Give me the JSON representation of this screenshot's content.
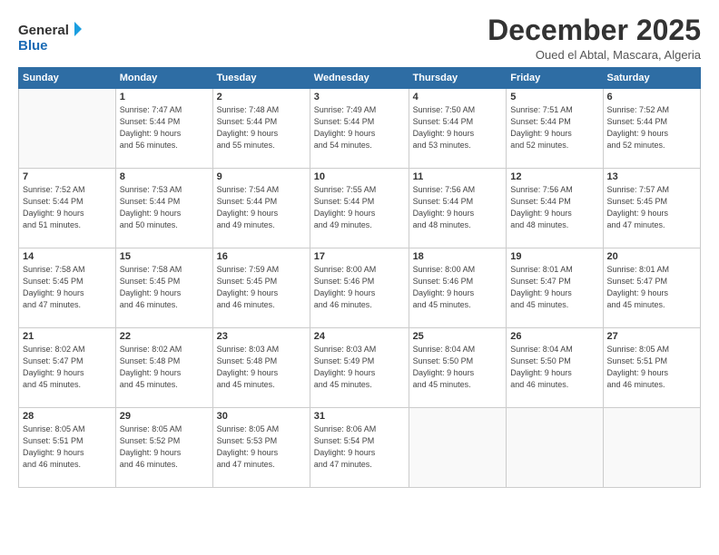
{
  "logo": {
    "line1": "General",
    "line2": "Blue"
  },
  "title": "December 2025",
  "subtitle": "Oued el Abtal, Mascara, Algeria",
  "days_of_week": [
    "Sunday",
    "Monday",
    "Tuesday",
    "Wednesday",
    "Thursday",
    "Friday",
    "Saturday"
  ],
  "weeks": [
    [
      {
        "day": "",
        "info": ""
      },
      {
        "day": "1",
        "info": "Sunrise: 7:47 AM\nSunset: 5:44 PM\nDaylight: 9 hours\nand 56 minutes."
      },
      {
        "day": "2",
        "info": "Sunrise: 7:48 AM\nSunset: 5:44 PM\nDaylight: 9 hours\nand 55 minutes."
      },
      {
        "day": "3",
        "info": "Sunrise: 7:49 AM\nSunset: 5:44 PM\nDaylight: 9 hours\nand 54 minutes."
      },
      {
        "day": "4",
        "info": "Sunrise: 7:50 AM\nSunset: 5:44 PM\nDaylight: 9 hours\nand 53 minutes."
      },
      {
        "day": "5",
        "info": "Sunrise: 7:51 AM\nSunset: 5:44 PM\nDaylight: 9 hours\nand 52 minutes."
      },
      {
        "day": "6",
        "info": "Sunrise: 7:52 AM\nSunset: 5:44 PM\nDaylight: 9 hours\nand 52 minutes."
      }
    ],
    [
      {
        "day": "7",
        "info": "Sunrise: 7:52 AM\nSunset: 5:44 PM\nDaylight: 9 hours\nand 51 minutes."
      },
      {
        "day": "8",
        "info": "Sunrise: 7:53 AM\nSunset: 5:44 PM\nDaylight: 9 hours\nand 50 minutes."
      },
      {
        "day": "9",
        "info": "Sunrise: 7:54 AM\nSunset: 5:44 PM\nDaylight: 9 hours\nand 49 minutes."
      },
      {
        "day": "10",
        "info": "Sunrise: 7:55 AM\nSunset: 5:44 PM\nDaylight: 9 hours\nand 49 minutes."
      },
      {
        "day": "11",
        "info": "Sunrise: 7:56 AM\nSunset: 5:44 PM\nDaylight: 9 hours\nand 48 minutes."
      },
      {
        "day": "12",
        "info": "Sunrise: 7:56 AM\nSunset: 5:44 PM\nDaylight: 9 hours\nand 48 minutes."
      },
      {
        "day": "13",
        "info": "Sunrise: 7:57 AM\nSunset: 5:45 PM\nDaylight: 9 hours\nand 47 minutes."
      }
    ],
    [
      {
        "day": "14",
        "info": "Sunrise: 7:58 AM\nSunset: 5:45 PM\nDaylight: 9 hours\nand 47 minutes."
      },
      {
        "day": "15",
        "info": "Sunrise: 7:58 AM\nSunset: 5:45 PM\nDaylight: 9 hours\nand 46 minutes."
      },
      {
        "day": "16",
        "info": "Sunrise: 7:59 AM\nSunset: 5:45 PM\nDaylight: 9 hours\nand 46 minutes."
      },
      {
        "day": "17",
        "info": "Sunrise: 8:00 AM\nSunset: 5:46 PM\nDaylight: 9 hours\nand 46 minutes."
      },
      {
        "day": "18",
        "info": "Sunrise: 8:00 AM\nSunset: 5:46 PM\nDaylight: 9 hours\nand 45 minutes."
      },
      {
        "day": "19",
        "info": "Sunrise: 8:01 AM\nSunset: 5:47 PM\nDaylight: 9 hours\nand 45 minutes."
      },
      {
        "day": "20",
        "info": "Sunrise: 8:01 AM\nSunset: 5:47 PM\nDaylight: 9 hours\nand 45 minutes."
      }
    ],
    [
      {
        "day": "21",
        "info": "Sunrise: 8:02 AM\nSunset: 5:47 PM\nDaylight: 9 hours\nand 45 minutes."
      },
      {
        "day": "22",
        "info": "Sunrise: 8:02 AM\nSunset: 5:48 PM\nDaylight: 9 hours\nand 45 minutes."
      },
      {
        "day": "23",
        "info": "Sunrise: 8:03 AM\nSunset: 5:48 PM\nDaylight: 9 hours\nand 45 minutes."
      },
      {
        "day": "24",
        "info": "Sunrise: 8:03 AM\nSunset: 5:49 PM\nDaylight: 9 hours\nand 45 minutes."
      },
      {
        "day": "25",
        "info": "Sunrise: 8:04 AM\nSunset: 5:50 PM\nDaylight: 9 hours\nand 45 minutes."
      },
      {
        "day": "26",
        "info": "Sunrise: 8:04 AM\nSunset: 5:50 PM\nDaylight: 9 hours\nand 46 minutes."
      },
      {
        "day": "27",
        "info": "Sunrise: 8:05 AM\nSunset: 5:51 PM\nDaylight: 9 hours\nand 46 minutes."
      }
    ],
    [
      {
        "day": "28",
        "info": "Sunrise: 8:05 AM\nSunset: 5:51 PM\nDaylight: 9 hours\nand 46 minutes."
      },
      {
        "day": "29",
        "info": "Sunrise: 8:05 AM\nSunset: 5:52 PM\nDaylight: 9 hours\nand 46 minutes."
      },
      {
        "day": "30",
        "info": "Sunrise: 8:05 AM\nSunset: 5:53 PM\nDaylight: 9 hours\nand 47 minutes."
      },
      {
        "day": "31",
        "info": "Sunrise: 8:06 AM\nSunset: 5:54 PM\nDaylight: 9 hours\nand 47 minutes."
      },
      {
        "day": "",
        "info": ""
      },
      {
        "day": "",
        "info": ""
      },
      {
        "day": "",
        "info": ""
      }
    ]
  ]
}
